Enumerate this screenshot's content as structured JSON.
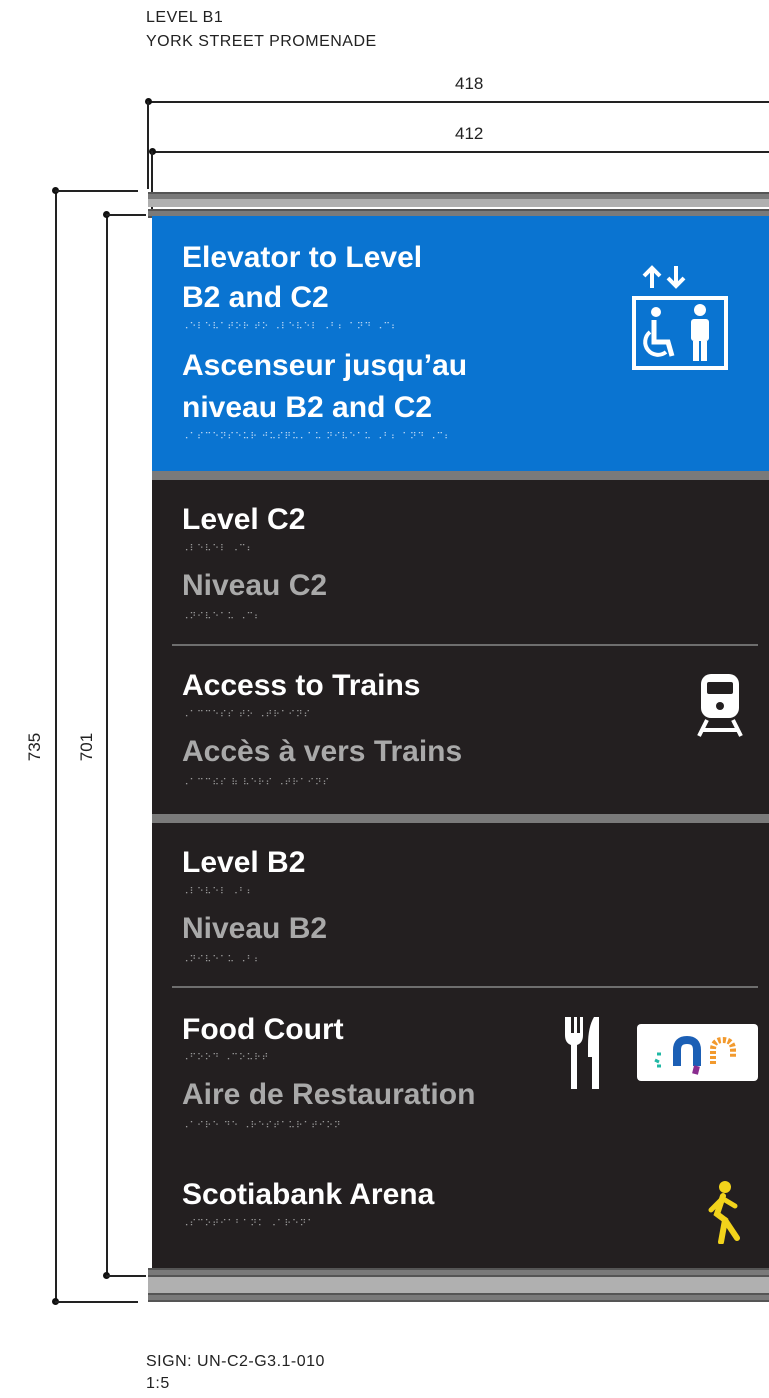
{
  "header": {
    "level": "LEVEL B1",
    "location": "YORK STREET PROMENADE"
  },
  "dimensions": {
    "outer_width": "418",
    "inner_width": "412",
    "outer_height": "735",
    "inner_height": "701"
  },
  "blue_panel": {
    "en_line1": "Elevator to Level",
    "en_line2": "B2 and C2",
    "braille_en": "⠠⠑⠇⠑⠧⠁⠞⠕⠗ ⠞⠕ ⠠⠇⠑⠧⠑⠇ ⠠⠃⠆ ⠁⠝⠙ ⠠⠉⠆",
    "fr_line1": "Ascenseur jusqu’au",
    "fr_line2": "niveau B2 and C2",
    "braille_fr": "⠠⠁⠎⠉⠑⠝⠎⠑⠥⠗ ⠚⠥⠎⠟⠥⠄⠁⠥ ⠝⠊⠧⠑⠁⠥ ⠠⠃⠆ ⠁⠝⠙ ⠠⠉⠆",
    "icon": "elevator-accessible-icon"
  },
  "entries": [
    {
      "en": "Level C2",
      "braille_en": "⠠⠇⠑⠧⠑⠇ ⠠⠉⠆",
      "fr": "Niveau C2",
      "braille_fr": "⠠⠝⠊⠧⠑⠁⠥ ⠠⠉⠆"
    },
    {
      "en": "Access to Trains",
      "braille_en": "⠠⠁⠉⠉⠑⠎⠎ ⠞⠕ ⠠⠞⠗⠁⠊⠝⠎",
      "fr": "Accès à vers Trains",
      "braille_fr": "⠠⠁⠉⠉⠮⠎ ⠷ ⠧⠑⠗⠎ ⠠⠞⠗⠁⠊⠝⠎",
      "icon": "train-icon"
    },
    {
      "en": "Level B2",
      "braille_en": "⠠⠇⠑⠧⠑⠇ ⠠⠃⠆",
      "fr": "Niveau B2",
      "braille_fr": "⠠⠝⠊⠧⠑⠁⠥ ⠠⠃⠆"
    },
    {
      "en": "Food Court",
      "braille_en": "⠠⠋⠕⠕⠙ ⠠⠉⠕⠥⠗⠞",
      "fr": "Aire de Restauration",
      "braille_fr": "⠠⠁⠊⠗⠑ ⠙⠑ ⠠⠗⠑⠎⠞⠁⠥⠗⠁⠞⠊⠕⠝",
      "icon": "fork-knife-icon"
    },
    {
      "en": "Scotiabank Arena",
      "braille_en": "⠠⠎⠉⠕⠞⠊⠁⠃⠁⠝⠅ ⠠⠁⠗⠑⠝⠁",
      "icon": "pedestrian-icon"
    }
  ],
  "colors": {
    "blue": "#0a74d1",
    "dark": "#231f20",
    "fr_grey": "#a9a9a9",
    "pedestrian_yellow": "#f2d31b"
  },
  "footer": {
    "sign_id": "SIGN: UN-C2-G3.1-010",
    "scale": "1:5"
  }
}
